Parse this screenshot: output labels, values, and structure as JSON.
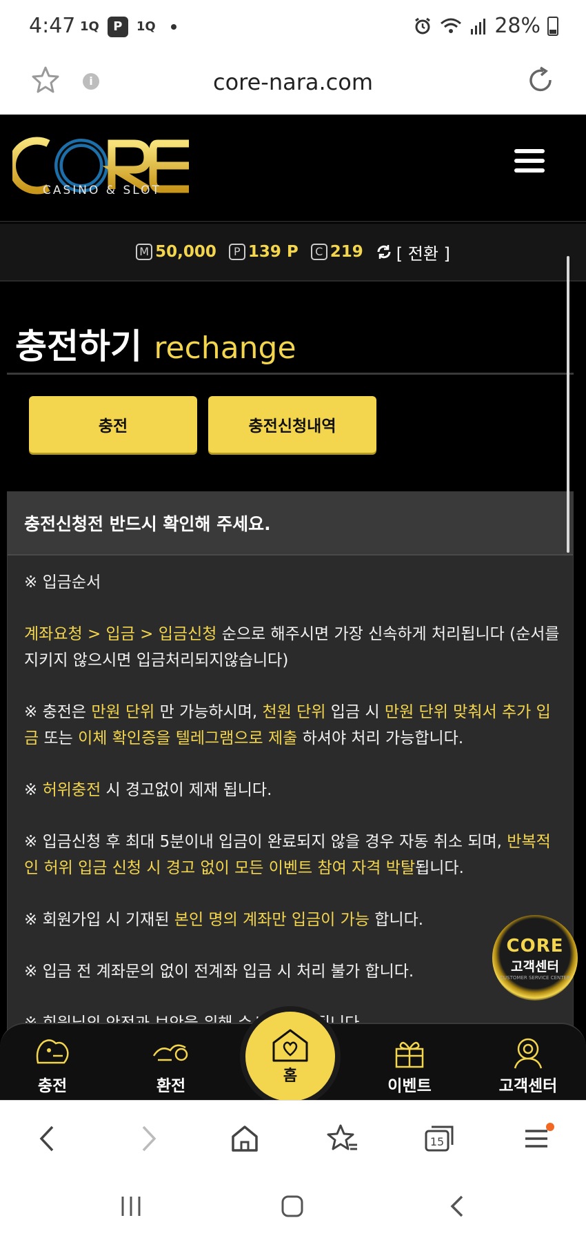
{
  "status": {
    "time": "4:47",
    "notifs": [
      "1Q",
      "P",
      "1Q"
    ],
    "battery": "28%"
  },
  "browser": {
    "url": "core-nara.com",
    "tab_count": "15"
  },
  "site": {
    "logo_text": "CORE",
    "logo_sub": "CASINO & SLOT",
    "balance": {
      "money_letter": "M",
      "money": "50,000",
      "point_letter": "P",
      "points": "139 P",
      "coin_letter": "C",
      "coins": "219",
      "switch_label": "[ 전환 ]"
    },
    "title_ko": "충전하기",
    "title_en": "rechange",
    "buttons": {
      "charge": "충전",
      "history": "충전신청내역"
    },
    "notice": {
      "heading": "충전신청전 반드시 확인해 주세요.",
      "p1": "※ 입금순서",
      "p2_y": "계좌요청 > 입금 > 입금신청",
      "p2_w": " 순으로 해주시면 가장 신속하게 처리됩니다 (순서를 지키지 않으시면 입금처리되지않습니다)",
      "p3_a": "※ 충전은 ",
      "p3_b": "만원 단위",
      "p3_c": " 만 가능하시며, ",
      "p3_d": "천원 단위",
      "p3_e": " 입금 시 ",
      "p3_f": "만원 단위 맞춰서 추가 입금",
      "p3_g": " 또는 ",
      "p3_h": "이체 확인증을 텔레그램으로 제출",
      "p3_i": " 하셔야 처리 가능합니다.",
      "p4_a": "※ ",
      "p4_b": "허위충전",
      "p4_c": " 시 경고없이 제재 됩니다.",
      "p5_a": "※ 입금신청 후 최대 5분이내 입금이 완료되지 않을 경우 자동 취소 되며, ",
      "p5_b": "반복적인 허위 입금 신청 시 경고 없이 모든 이벤트 참여 자격 박탈",
      "p5_c": "됩니다.",
      "p6_a": "※ 회원가입 시 기재된 ",
      "p6_b": "본인 명의 계좌만 입금이 가능",
      "p6_c": " 합니다.",
      "p7": "※ 입금 전 계좌문의 없이 전계좌 입금 시 처리 불가 합니다.",
      "p8": "※ 회원님의 안전과 보안을 위해 수시로 변경됩니다"
    },
    "cs_fab": {
      "logo": "CORE",
      "label": "고객센터",
      "sub": "CUSTOMER SERVICE CENTER"
    },
    "nav": {
      "charge": "충전",
      "exchange": "환전",
      "home": "홈",
      "event": "이벤트",
      "support": "고객센터"
    }
  },
  "colors": {
    "accent": "#f3d54e",
    "background": "#000000",
    "panel": "#2b2b2b"
  }
}
